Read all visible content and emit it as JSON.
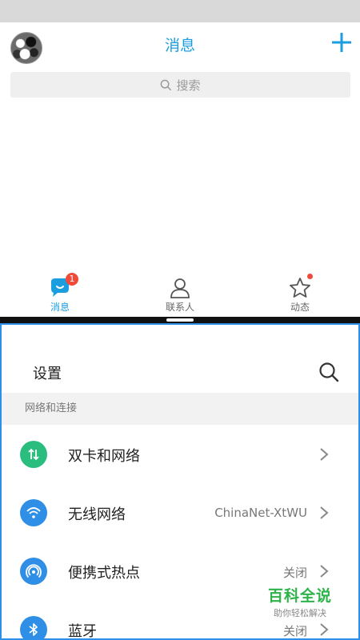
{
  "top_app": {
    "title": "消息",
    "search_placeholder": "搜索",
    "accent_color": "#1a9ee0",
    "tabs": [
      {
        "label": "消息",
        "icon": "chat-bubble-icon",
        "badge": "1",
        "active": true
      },
      {
        "label": "联系人",
        "icon": "person-icon",
        "active": false
      },
      {
        "label": "动态",
        "icon": "star-icon",
        "dot": true,
        "active": false
      }
    ]
  },
  "settings": {
    "title": "设置",
    "section_header": "网络和连接",
    "rows": [
      {
        "label": "双卡和网络",
        "value": "",
        "icon": "dual-sim-arrows-icon",
        "icon_color": "#2bbd7e"
      },
      {
        "label": "无线网络",
        "value": "ChinaNet-XtWU",
        "icon": "wifi-icon",
        "icon_color": "#2f8fe6"
      },
      {
        "label": "便携式热点",
        "value": "关闭",
        "icon": "hotspot-icon",
        "icon_color": "#2f8fe6"
      },
      {
        "label": "蓝牙",
        "value": "关闭",
        "icon": "bluetooth-icon",
        "icon_color": "#2f8fe6"
      }
    ]
  },
  "watermark": {
    "main": "百科全说",
    "sub": "助你轻松解决",
    "color": "#2db34a"
  }
}
